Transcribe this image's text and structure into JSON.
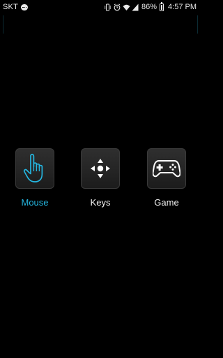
{
  "status_bar": {
    "carrier": "SKT",
    "battery_percent": "86%",
    "time": "4:57 PM"
  },
  "modes": [
    {
      "label": "Mouse",
      "icon": "hand-pointer-icon",
      "active": true
    },
    {
      "label": "Keys",
      "icon": "dpad-icon",
      "active": false
    },
    {
      "label": "Game",
      "icon": "gamepad-icon",
      "active": false
    }
  ],
  "colors": {
    "background": "#000000",
    "accent": "#24b6e0",
    "tile": "#262626",
    "label": "#f2f2f2"
  }
}
